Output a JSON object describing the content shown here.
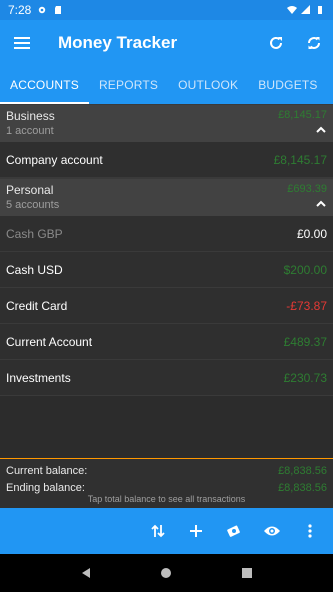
{
  "status_bar": {
    "time": "7:28"
  },
  "app_bar": {
    "title": "Money Tracker"
  },
  "tabs": [
    {
      "label": "ACCOUNTS",
      "active": true
    },
    {
      "label": "REPORTS",
      "active": false
    },
    {
      "label": "OUTLOOK",
      "active": false
    },
    {
      "label": "BUDGETS",
      "active": false
    }
  ],
  "groups": [
    {
      "name": "Business",
      "count": "1 account",
      "balance": "£8,145.17",
      "accounts": [
        {
          "name": "Company account",
          "balance": "£8,145.17"
        }
      ]
    },
    {
      "name": "Personal",
      "count": "5 accounts",
      "balance": "£693.39",
      "accounts": [
        {
          "name": "Cash GBP",
          "balance": "£0.00"
        },
        {
          "name": "Cash USD",
          "balance": "$200.00"
        },
        {
          "name": "Credit Card",
          "balance": "-£73.87"
        },
        {
          "name": "Current Account",
          "balance": "£489.37"
        },
        {
          "name": "Investments",
          "balance": "£230.73"
        }
      ]
    }
  ],
  "totals": {
    "current_label": "Current balance:",
    "current_value": "£8,838.56",
    "ending_label": "Ending balance:",
    "ending_value": "£8,838.56",
    "hint": "Tap total balance to see all transactions"
  },
  "colors": {
    "primary": "#2196f3",
    "positive": "#2e7d32",
    "negative": "#e53935",
    "accent_line": "#ff9800"
  }
}
